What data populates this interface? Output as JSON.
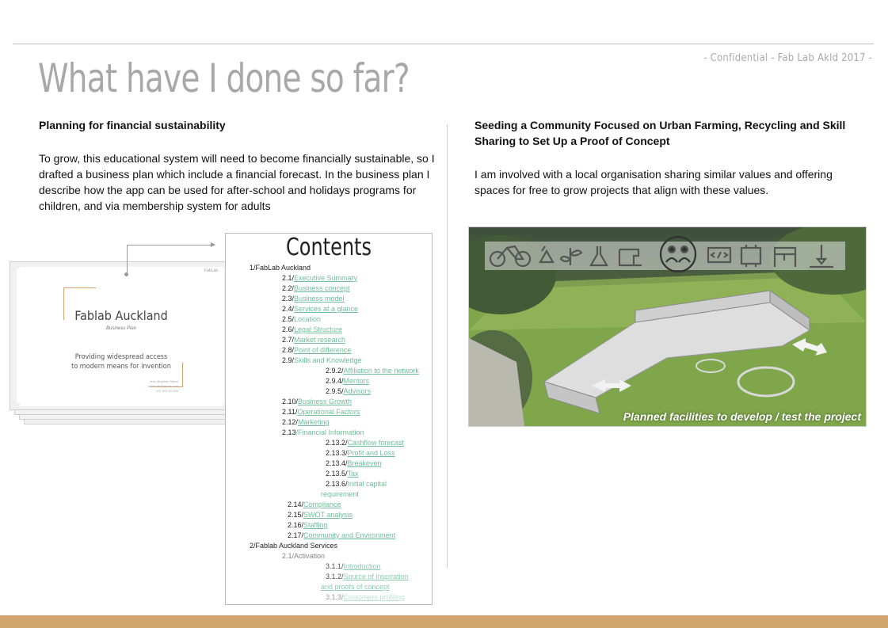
{
  "header": {
    "confidential": "- Confidential - Fab Lab Akld 2017 -",
    "title": "What have I done so far?"
  },
  "left": {
    "heading": "Planning for financial sustainability",
    "body": "To grow, this educational system will need to become financially sustainable, so I drafted a business plan which include a financial forecast. In the business plan I describe how the app can be used for after-school and holidays programs for children, and via membership system for adults"
  },
  "right": {
    "heading": "Seeding a Community Focused on Urban Farming, Recycling and Skill Sharing to Set Up a Proof of Concept",
    "body": "I am involved with a local organisation sharing similar values and offering spaces for free to grow projects that align with these values."
  },
  "cover": {
    "tag": "FabLab",
    "title": "Fablab Auckland",
    "subtitle": "Business Plan",
    "tagline_line1": "Providing widespread access",
    "tagline_line2": "to modern means for invention",
    "contact_line1": "Jean-Baptiste Rabat",
    "contact_line2": "fablabakl@gmail.com",
    "contact_line3": "021 000 00 000"
  },
  "toc": {
    "title": "Contents",
    "items": [
      {
        "num": "1/FabLab Auckland",
        "label": "",
        "indent": 30,
        "style": "plain"
      },
      {
        "num": "2.1/",
        "label": "Executive Summary",
        "indent": 71,
        "style": "link"
      },
      {
        "num": "2.2/",
        "label": "Business concept",
        "indent": 71,
        "style": "link"
      },
      {
        "num": "2.3/",
        "label": "Business model",
        "indent": 71,
        "style": "link"
      },
      {
        "num": "2.4/",
        "label": "Services at a glance",
        "indent": 71,
        "style": "link"
      },
      {
        "num": "2.5/",
        "label": "Location",
        "indent": 71,
        "style": "green"
      },
      {
        "num": "2.6/",
        "label": "Legal Structure",
        "indent": 71,
        "style": "link"
      },
      {
        "num": "2.7/",
        "label": "Market research",
        "indent": 71,
        "style": "link"
      },
      {
        "num": "2.8/",
        "label": "Point of difference",
        "indent": 71,
        "style": "link"
      },
      {
        "num": "2.9/",
        "label": "Skills and Knowledge",
        "indent": 71,
        "style": "green"
      },
      {
        "num": "2.9.2/",
        "label": "Affiliation to the network",
        "indent": 126,
        "style": "link"
      },
      {
        "num": "2.9.4/",
        "label": "Mentors",
        "indent": 126,
        "style": "link"
      },
      {
        "num": "2.9.5/",
        "label": "Advisors",
        "indent": 126,
        "style": "link"
      },
      {
        "num": "2.10/",
        "label": "Business Growth",
        "indent": 71,
        "style": "link"
      },
      {
        "num": "2.11/",
        "label": "Operational Factors",
        "indent": 71,
        "style": "link"
      },
      {
        "num": "2.12/",
        "label": "Marketing",
        "indent": 71,
        "style": "link"
      },
      {
        "num": "2.13",
        "label": "/Financial Information",
        "indent": 71,
        "style": "green"
      },
      {
        "num": "2.13.2/",
        "label": "Cashflow forecast",
        "indent": 126,
        "style": "link"
      },
      {
        "num": "2.13.3/",
        "label": "Profit and Loss",
        "indent": 126,
        "style": "link"
      },
      {
        "num": "2.13.4/",
        "label": "Breakeven",
        "indent": 126,
        "style": "link"
      },
      {
        "num": "2.13.5/",
        "label": "Tax",
        "indent": 126,
        "style": "link"
      },
      {
        "num": "2.13.6/",
        "label": "Initial capital",
        "indent": 126,
        "style": "green"
      },
      {
        "num": "",
        "label": "requirement",
        "indent": 120,
        "style": "green"
      },
      {
        "num": "2.14/",
        "label": "Compliance",
        "indent": 78,
        "style": "link"
      },
      {
        "num": "2.15/",
        "label": "SWOT analysis",
        "indent": 78,
        "style": "link"
      },
      {
        "num": "2.16/",
        "label": "Staffing",
        "indent": 78,
        "style": "link"
      },
      {
        "num": "2.17/",
        "label": "Community and Environment",
        "indent": 78,
        "style": "link"
      },
      {
        "num": "2/Fablab Auckland Services",
        "label": "",
        "indent": 30,
        "style": "plain"
      },
      {
        "num": "2.1/Activation",
        "label": "",
        "indent": 71,
        "style": "plain",
        "fade": 1
      },
      {
        "num": "3.1.1/",
        "label": "Introduction",
        "indent": 126,
        "style": "link",
        "fade": 1
      },
      {
        "num": "3.1.2/",
        "label": "Source of inspiration",
        "indent": 126,
        "style": "link",
        "fade": 1
      },
      {
        "num": "",
        "label": "and proofs of concept",
        "indent": 120,
        "style": "link",
        "fade": 1
      },
      {
        "num": "3.1.3/",
        "label": "Customers profiling",
        "indent": 126,
        "style": "link",
        "fade": 2
      }
    ]
  },
  "photo": {
    "caption": "Planned facilities to develop / test the project",
    "icons": [
      "bicycle-icon",
      "recycle-icon",
      "plant-icon",
      "flask-icon",
      "sewing-machine-icon",
      "people-icon",
      "code-icon",
      "circuit-board-icon",
      "3d-printer-icon",
      "laser-cutter-icon"
    ]
  },
  "colors": {
    "title": "#a8a8a8",
    "link": "#6fbf9a",
    "accent": "#d1a46e"
  }
}
